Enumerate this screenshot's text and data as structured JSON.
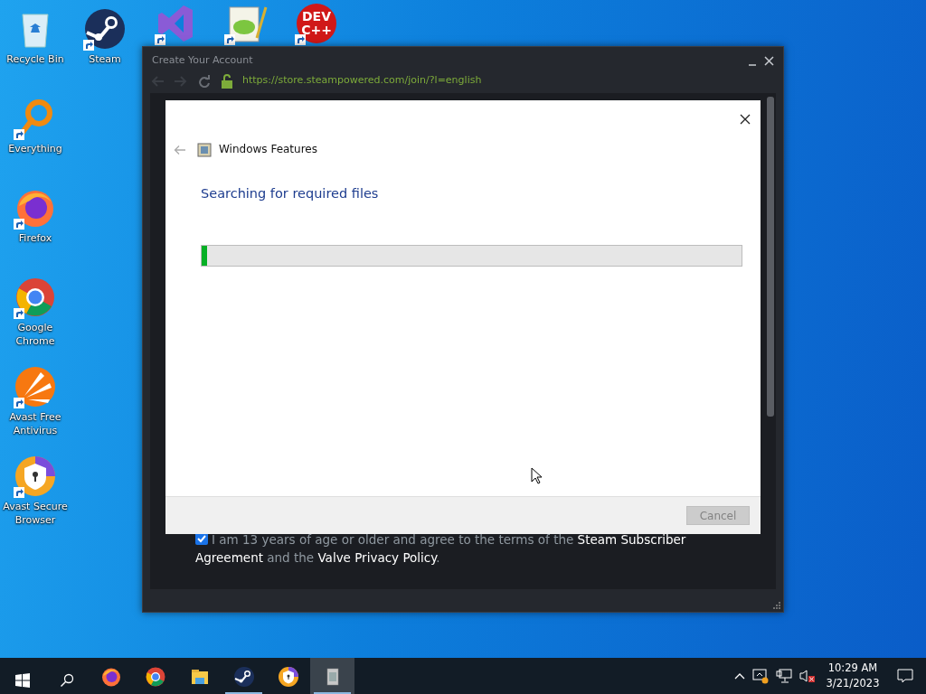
{
  "desktop_icons": [
    {
      "kind": "recycle",
      "label": "Recycle Bin",
      "shortcut": false
    },
    {
      "kind": "steam",
      "label": "Steam",
      "shortcut": true
    },
    {
      "kind": "vs",
      "shortcut": true
    },
    {
      "kind": "notepad",
      "shortcut": true
    },
    {
      "kind": "devcpp",
      "logo_text": [
        "DEV",
        "C++"
      ],
      "shortcut": true
    },
    {
      "kind": "everything",
      "label": "Everything",
      "shortcut": true
    },
    {
      "kind": "firefox",
      "label": "Firefox",
      "shortcut": true
    },
    {
      "kind": "chrome",
      "label": "Google Chrome",
      "shortcut": true
    },
    {
      "kind": "avast",
      "label": "Avast Free Antivirus",
      "shortcut": true
    },
    {
      "kind": "avastbrowser",
      "label": "Avast Secure Browser",
      "shortcut": true
    }
  ],
  "steam_window": {
    "title": "Create Your Account",
    "url": "https://store.steampowered.com/join/?l=english",
    "agreement": {
      "checked": true,
      "text": "I am 13 years of age or older and agree to the terms of the **Steam Subscriber Agreement** and the **Valve Privacy Policy**."
    }
  },
  "dialog": {
    "title": "Windows Features",
    "heading": "Searching for required files",
    "progress": {
      "level": 0.01
    },
    "buttons": [
      {
        "label": "Cancel",
        "disabled": true
      }
    ]
  },
  "taskbar": {
    "items": [
      {
        "kind": "start",
        "running": false,
        "selected": false
      },
      {
        "kind": "search",
        "running": false,
        "selected": false
      },
      {
        "kind": "firefox",
        "running": false,
        "selected": false
      },
      {
        "kind": "chrome",
        "running": false,
        "selected": false
      },
      {
        "kind": "explorer",
        "running": false,
        "selected": false
      },
      {
        "kind": "steam",
        "running": true,
        "selected": false
      },
      {
        "kind": "avastbrowser",
        "running": false,
        "selected": false
      },
      {
        "kind": "features",
        "running": true,
        "selected": true
      }
    ],
    "time": "10:29 AM",
    "date": "3/21/2023"
  }
}
